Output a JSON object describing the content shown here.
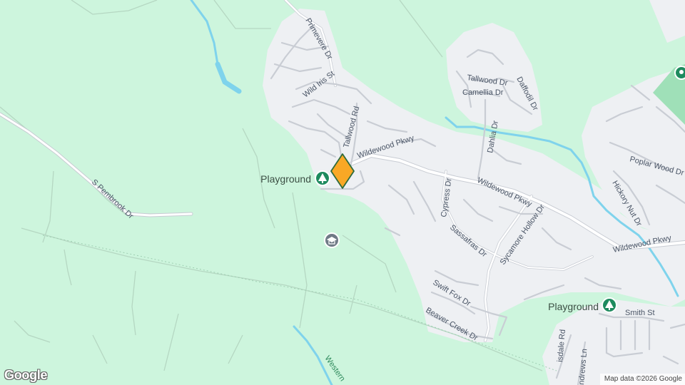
{
  "map": {
    "colors": {
      "park": "#cdf5dd",
      "residential": "#eef0f3",
      "road": "#ffffff",
      "road_outline": "#c8ccd3",
      "water": "#7fd3ec",
      "green_poi": "#1e8a5e",
      "marker": "#f9a825"
    },
    "street_labels": {
      "primevere": "Primevere Dr",
      "wild_iris": "Wild Iris St",
      "tallwood_rd": "Tallwood Rd",
      "wildewood_1": "Wildewood Pkwy",
      "wildewood_2": "Wildewood Pkwy",
      "wildewood_3": "Wildewood Pkwy",
      "tallwood_dr": "Tallwood Dr",
      "camellia": "Camellia Dr",
      "daffodil": "Daffodil Dr",
      "dahlia": "Dahlia Dr",
      "cypress": "Cypress Dr",
      "sassafras": "Sassafras Dr",
      "sycamore": "Sycamore Hollow Dr",
      "swift_fox": "Swift Fox Dr",
      "beaver_creek": "Beaver Creek Dr",
      "s_pembrook": "S Pembrook Dr",
      "poplar_wood": "Poplar Wood Dr",
      "hickory_nut": "Hickory Nut Dr",
      "smith": "Smith St",
      "western": "Western",
      "wisdale": "isdale Rd",
      "andrews": "ndrews Ln"
    },
    "pois": {
      "playground_1": "Playground",
      "playground_2": "Playground",
      "school_icon": "school-icon",
      "tree_icon": "tree-icon",
      "pin_icon": "map-pin-icon"
    },
    "marker_icon": "location-marker-icon"
  },
  "footer": {
    "logo": "Google",
    "attribution": "Map data ©2026 Google"
  }
}
